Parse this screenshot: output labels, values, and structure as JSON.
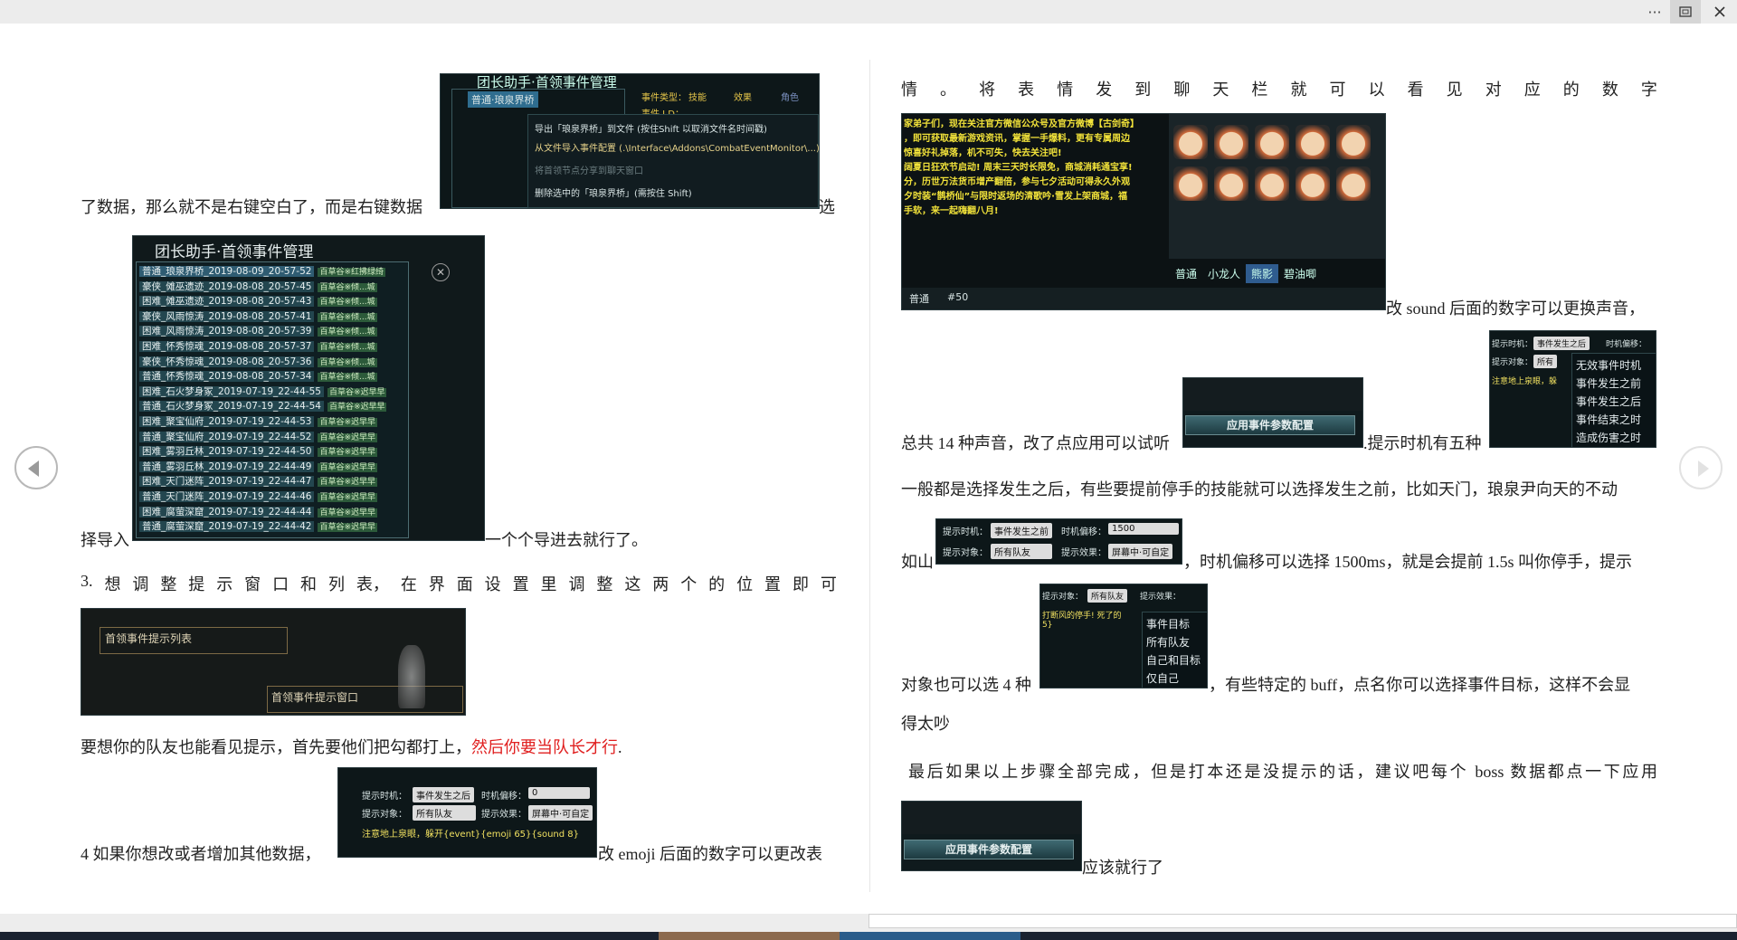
{
  "window": {
    "more_icon": "more-icon",
    "fit_icon": "fit-icon",
    "close_icon": "close-icon"
  },
  "left": {
    "line1_tail": "选",
    "line1_text": "了数据，那么就不是右键空白了，而是右键数据",
    "line2_pre": "择导入",
    "line2_post": "一个个导进去就行了。",
    "line3_chars": [
      "3.",
      "想",
      "调",
      "整",
      "提",
      "示",
      "窗",
      "口",
      "和",
      "列",
      "表，",
      "在",
      "界",
      "面",
      "设",
      "置",
      "里",
      "调",
      "整",
      "这",
      "两",
      "个",
      "的",
      "位",
      "置",
      "即",
      "可"
    ],
    "line4_pre": "要想你的队友也能看见提示，首先要他们把勾都打上，",
    "line4_red": "然后你要当队长才行",
    "line4_post": ".",
    "line5_pre": "4 如果你想改或者增加其他数据，",
    "line5_post": "改 emoji 后面的数字可以更改表"
  },
  "right": {
    "line1_chars": [
      "情",
      "。",
      "将",
      "表",
      "情",
      "发",
      "到",
      "聊",
      "天",
      "栏",
      "就",
      "可",
      "以",
      "看",
      "见",
      "对",
      "应",
      "的",
      "数",
      "字"
    ],
    "line2_tail": "改 sound 后面的数字可以更换声音，",
    "line3_pre": "总共 14 种声音，改了点应用可以试听",
    "line3_post": ".提示时机有五种",
    "line4": "一般都是选择发生之后，有些要提前停手的技能就可以选择发生之前，比如天门，琅泉尹向天的不动",
    "line5_pre": "如山",
    "line5_post": "，时机偏移可以选择 1500ms，就是会提前 1.5s 叫你停手，提示",
    "line6_pre": "对象也可以选 4 种",
    "line6_post": "，有些特定的 buff，点名你可以选择事件目标，这样不会显",
    "line7": "得太吵",
    "line8": "最后如果以上步骤全部完成，但是打本还是没提示的话，建议吧每个  boss  数据都点一下应用",
    "line9": "应该就行了"
  },
  "shot_context_menu": {
    "title": "团长助手·首领事件管理",
    "node": "普通·琅泉界桥",
    "type_label": "事件类型：",
    "type_opts": [
      "技能",
      "效果",
      "角色"
    ],
    "id_label": "事件 I D：",
    "items": [
      "导出「琅泉界桥」到文件 (按住Shift 以取消文件名时间戳)",
      "从文件导入事件配置 (.\\Interface\\Addons\\CombatEventMonitor\\...)",
      "将首领节点分享到聊天窗口",
      "删除选中的「琅泉界桥」(需按住 Shift)"
    ]
  },
  "shot_file_list": {
    "title": "团长助手·首领事件管理",
    "files": [
      {
        "name": "普通_琅泉界桥_2019-08-09_20-57-52",
        "tag": "百草谷※红拂绿绮"
      },
      {
        "name": "豪侠_傩巫遗迹_2019-08-08_20-57-45",
        "tag": "百草谷※倾...城"
      },
      {
        "name": "困难_傩巫遗迹_2019-08-08_20-57-43",
        "tag": "百草谷※倾...城"
      },
      {
        "name": "豪侠_风雨惊涛_2019-08-08_20-57-41",
        "tag": "百草谷※倾...城"
      },
      {
        "name": "困难_风雨惊涛_2019-08-08_20-57-39",
        "tag": "百草谷※倾...城"
      },
      {
        "name": "困难_怀秀惊魂_2019-08-08_20-57-37",
        "tag": "百草谷※倾...城"
      },
      {
        "name": "豪侠_怀秀惊魂_2019-08-08_20-57-36",
        "tag": "百草谷※倾...城"
      },
      {
        "name": "普通_怀秀惊魂_2019-08-08_20-57-34",
        "tag": "百草谷※倾...城"
      },
      {
        "name": "困难_石火梦身冢_2019-07-19_22-44-55",
        "tag": "百草谷※迟早早"
      },
      {
        "name": "普通_石火梦身冢_2019-07-19_22-44-54",
        "tag": "百草谷※迟早早"
      },
      {
        "name": "困难_聚宝仙府_2019-07-19_22-44-53",
        "tag": "百草谷※迟早早"
      },
      {
        "name": "普通_聚宝仙府_2019-07-19_22-44-52",
        "tag": "百草谷※迟早早"
      },
      {
        "name": "困难_雾羽丘林_2019-07-19_22-44-50",
        "tag": "百草谷※迟早早"
      },
      {
        "name": "普通_雾羽丘林_2019-07-19_22-44-49",
        "tag": "百草谷※迟早早"
      },
      {
        "name": "困难_天门迷阵_2019-07-19_22-44-47",
        "tag": "百草谷※迟早早"
      },
      {
        "name": "普通_天门迷阵_2019-07-19_22-44-46",
        "tag": "百草谷※迟早早"
      },
      {
        "name": "困难_腐萤深窟_2019-07-19_22-44-44",
        "tag": "百草谷※迟早早"
      },
      {
        "name": "普通_腐萤深窟_2019-07-19_22-44-42",
        "tag": "百草谷※迟早早"
      }
    ]
  },
  "shot_windows": {
    "list_label": "首领事件提示列表",
    "window_label": "首领事件提示窗口"
  },
  "shot_emoji_config": {
    "row1_a": "提示时机：",
    "row1_b": "事件发生之后",
    "row1_c": "时机偏移：",
    "row1_d": "0",
    "row2_a": "提示对象：",
    "row2_b": "所有队友",
    "row2_c": "提示效果：",
    "row2_d": "屏幕中·可自定",
    "row3": "注意地上泉眼，躲开{event}{emoji 65}{sound 8}"
  },
  "shot_chat": {
    "lines": [
      "家弟子们，现在关注官方微信公众号及官方微博【古剑奇】",
      "，即可获取最新游戏资讯，掌握一手爆料，更有专属周边",
      "惊喜好礼掉落，机不可失，快去关注吧!",
      "阔夏日狂欢节启动! 周末三天时长限免，商城消耗通宝享!",
      "分，历世万法货币增产翻倍，参与七夕活动可得永久外观",
      "夕时装“鹊桥仙”与限时返场的清歌吟·雪发上架商城，福",
      "手软，来一起嗨翻八月!"
    ],
    "tabs": [
      "普通",
      "小龙人",
      "熊影",
      "碧油唧"
    ],
    "input_channel": "普通",
    "input_text": "#50"
  },
  "shot_apply": {
    "button": "应用事件参数配置"
  },
  "shot_timing_menu": {
    "a": "提示时机：",
    "b": "事件发生之后",
    "c": "时机偏移：",
    "d": "提示对象：",
    "e": "所有",
    "f": "注意地上泉眼，躲",
    "options": [
      "无效事件时机",
      "事件发生之前",
      "事件发生之后",
      "事件结束之时",
      "造成伤害之时"
    ]
  },
  "shot_before": {
    "a": "提示时机：",
    "b": "事件发生之前",
    "c": "时机偏移：",
    "d": "1500",
    "e": "提示对象：",
    "f": "所有队友",
    "g": "提示效果：",
    "h": "屏幕中·可自定"
  },
  "shot_target_menu": {
    "a": "提示对象：",
    "b": "所有队友",
    "c": "提示效果：",
    "note": "打断风的停手! 死了的",
    "note2": "5}",
    "options": [
      "事件目标",
      "所有队友",
      "自己和目标",
      "仅自己"
    ]
  }
}
